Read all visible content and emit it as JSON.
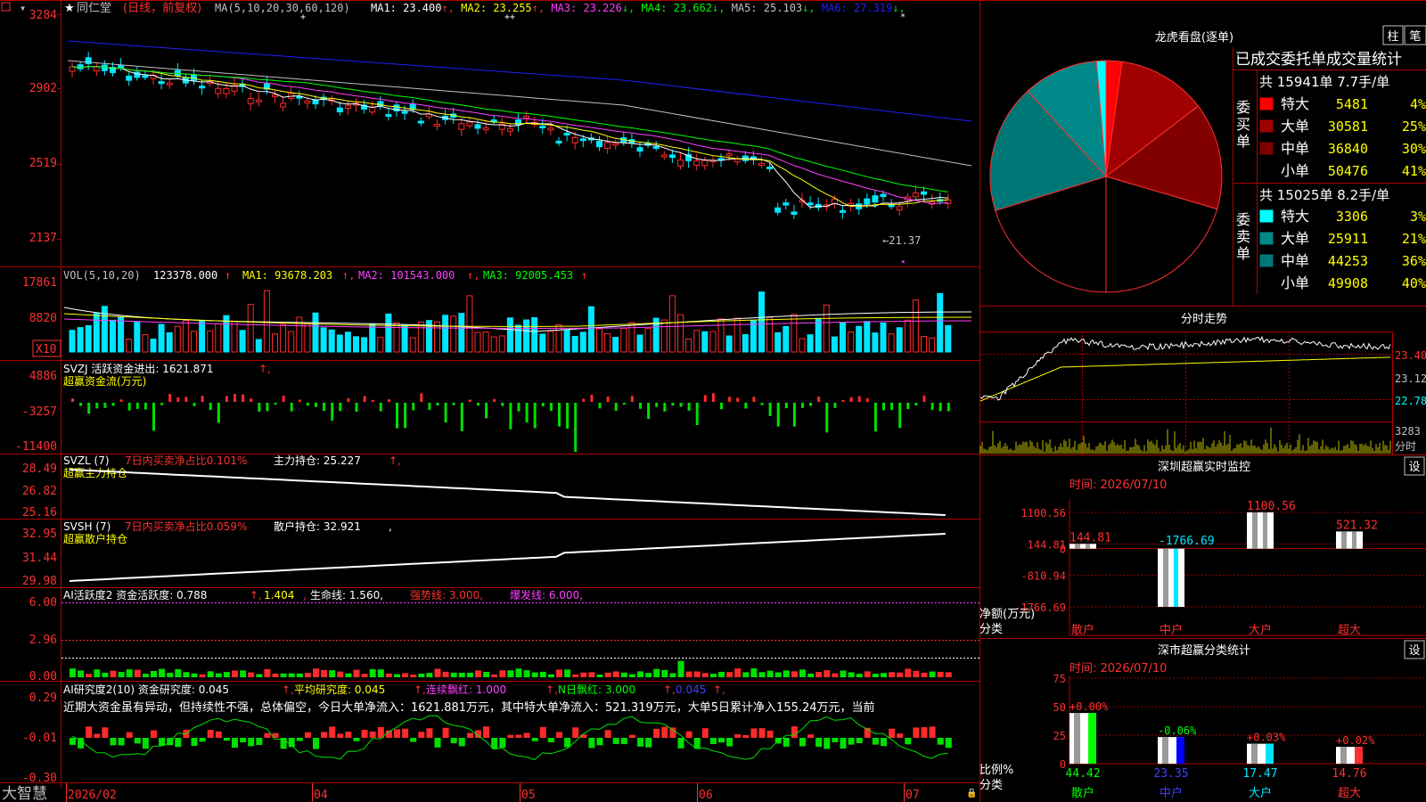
{
  "app": {
    "name": "大智慧",
    "stock_title": "同仁堂",
    "period_label": "(日线，前复权)"
  },
  "colors": {
    "up": "#ff2a2a",
    "down": "#00e5ff",
    "green": "#00e000",
    "ma1": "#ffffff",
    "ma2": "#ffff00",
    "ma3": "#ff40ff",
    "ma4": "#00ff00",
    "ma5": "#c0c0c0",
    "ma6": "#2020ff",
    "panel_border": "#b00000",
    "yellow": "#ffff00",
    "pink": "#ff40ff"
  },
  "main_panel": {
    "ma_label": "MA(5,10,20,30,60,120)",
    "ma": [
      {
        "label": "MA1:",
        "value": "23.400",
        "arrow": "↑"
      },
      {
        "label": "MA2:",
        "value": "23.255",
        "arrow": "↑"
      },
      {
        "label": "MA3:",
        "value": "23.226",
        "arrow": "↓"
      },
      {
        "label": "MA4:",
        "value": "23.662",
        "arrow": "↓"
      },
      {
        "label": "MA5:",
        "value": "25.103",
        "arrow": "↓"
      },
      {
        "label": "MA6:",
        "value": "27.319",
        "arrow": "↓"
      }
    ],
    "y_ticks": [
      "3284",
      "2902",
      "2519",
      "2137"
    ],
    "low_marker": "←21.37"
  },
  "vol_panel": {
    "header": "VOL(5,10,20)",
    "value": "123378.000",
    "ma1": "MA1: 93678.203",
    "ma2": "MA2: 101543.000",
    "ma3": "MA3: 92005.453",
    "y_ticks": [
      "17861",
      "8820"
    ],
    "unit": "X10"
  },
  "svzj_panel": {
    "header": "SVZJ  活跃资金进出: 1621.871",
    "sub": "超赢资金流(万元)",
    "y_ticks": [
      "4886",
      "-3257",
      "-11400"
    ]
  },
  "svzl_panel": {
    "header_a": "SVZL (7)",
    "header_b": "7日内买卖净占比0.101%",
    "header_c": "主力持仓: 25.227",
    "sub": "超赢主力持仓",
    "y_ticks": [
      "28.49",
      "26.82",
      "25.16"
    ]
  },
  "svsh_panel": {
    "header_a": "SVSH (7)",
    "header_b": "7日内买卖净占比0.059%",
    "header_c": "散户持仓: 32.921",
    "sub": "超赢散户持仓",
    "y_ticks": [
      "32.95",
      "31.44",
      "29.98"
    ]
  },
  "ai1_panel": {
    "header_a": "AI活跃度2 资金活跃度: 0.788",
    "header_b": "1.404",
    "header_c": "生命线: 1.560,",
    "header_d": "强势线: 3.000,",
    "header_e": "爆发线: 6.000,",
    "y_ticks": [
      "6.00",
      "2.96",
      "0.00"
    ]
  },
  "ai2_panel": {
    "header_a": "AI研究度2(10) 资金研究度: 0.045",
    "header_b": "平均研究度: 0.045",
    "header_c": "连续飘红: 1.000",
    "header_d": "N日飘红: 3.000",
    "header_e": "0.045",
    "comment": "近期大资金虽有异动，但持续性不强，总体偏空，今日大单净流入：1621.881万元，其中特大单净流入：521.319万元，大单5日累计净入155.24万元，当前",
    "y_ticks": [
      "0.29",
      "-0.01",
      "-0.30"
    ]
  },
  "date_axis": [
    "2026/02",
    "04",
    "05",
    "06",
    "07"
  ],
  "pie": {
    "title": "龙虎看盘(逐单)",
    "btn_a": "柱",
    "btn_b": "笔",
    "table_title": "已成交委托单成交量统计",
    "buy_label": "委买单",
    "sell_label": "委卖单",
    "buy_summary": "共 15941单 7.7手/单",
    "sell_summary": "共 15025单 8.2手/单",
    "buy_rows": [
      {
        "name": "特大",
        "value": "5481",
        "pct": "4%",
        "color": "#ff0000"
      },
      {
        "name": "大单",
        "value": "30581",
        "pct": "25%",
        "color": "#a00000"
      },
      {
        "name": "中单",
        "value": "36840",
        "pct": "30%",
        "color": "#800000"
      },
      {
        "name": "小单",
        "value": "50476",
        "pct": "41%",
        "color": "#000000"
      }
    ],
    "sell_rows": [
      {
        "name": "特大",
        "value": "3306",
        "pct": "3%",
        "color": "#00ffff"
      },
      {
        "name": "大单",
        "value": "25911",
        "pct": "21%",
        "color": "#008888"
      },
      {
        "name": "中单",
        "value": "44253",
        "pct": "36%",
        "color": "#007777"
      },
      {
        "name": "小单",
        "value": "49908",
        "pct": "40%",
        "color": "#000000"
      }
    ]
  },
  "intraday": {
    "title": "分时走势",
    "y_ticks": [
      "23.40",
      "23.12",
      "22.78"
    ],
    "vol_tick": "3283",
    "vol_unit": "分时"
  },
  "monitor": {
    "title": "深圳超赢实时监控",
    "setting": "设",
    "time": "时间: 2026/07/10",
    "y_ticks": [
      "1100.56",
      "144.81",
      "0",
      "-810.94",
      "-1766.69"
    ],
    "bar_labels": [
      "144.81",
      "-1766.69",
      "1100.56",
      "521.32"
    ],
    "categories": [
      "散户",
      "中户",
      "大户",
      "超大"
    ],
    "ylabel": "净额(万元)",
    "xlabel": "分类"
  },
  "classify": {
    "title": "深市超赢分类统计",
    "setting": "设",
    "time": "时间: 2026/07/10",
    "y_ticks": [
      "75",
      "50",
      "25",
      "0"
    ],
    "change_labels": [
      "+0.00%",
      "-0.06%",
      "+0.03%",
      "+0.02%"
    ],
    "values_labels": [
      "44.42",
      "23.35",
      "17.47",
      "14.76"
    ],
    "categories": [
      "散户",
      "中户",
      "大户",
      "超大"
    ],
    "ylabel": "比例%",
    "xlabel": "分类"
  },
  "chart_data": [
    {
      "type": "bar",
      "title": "深圳超赢实时监控",
      "xlabel": "分类",
      "ylabel": "净额(万元)",
      "categories": [
        "散户",
        "中户",
        "大户",
        "超大"
      ],
      "values": [
        144.81,
        -1766.69,
        1100.56,
        521.32
      ],
      "ylim": [
        -1766.69,
        1100.56
      ]
    },
    {
      "type": "bar",
      "title": "深市超赢分类统计",
      "xlabel": "分类",
      "ylabel": "比例%",
      "categories": [
        "散户",
        "中户",
        "大户",
        "超大"
      ],
      "values": [
        44.42,
        23.35,
        17.47,
        14.76
      ],
      "ylim": [
        0,
        75
      ]
    },
    {
      "type": "pie",
      "title": "龙虎看盘(逐单)",
      "categories": [
        "委买特大",
        "委买大单",
        "委买中单",
        "委买小单",
        "委卖特大",
        "委卖大单",
        "委卖中单",
        "委卖小单"
      ],
      "values": [
        5481,
        30581,
        36840,
        50476,
        3306,
        25911,
        44253,
        49908
      ]
    }
  ]
}
